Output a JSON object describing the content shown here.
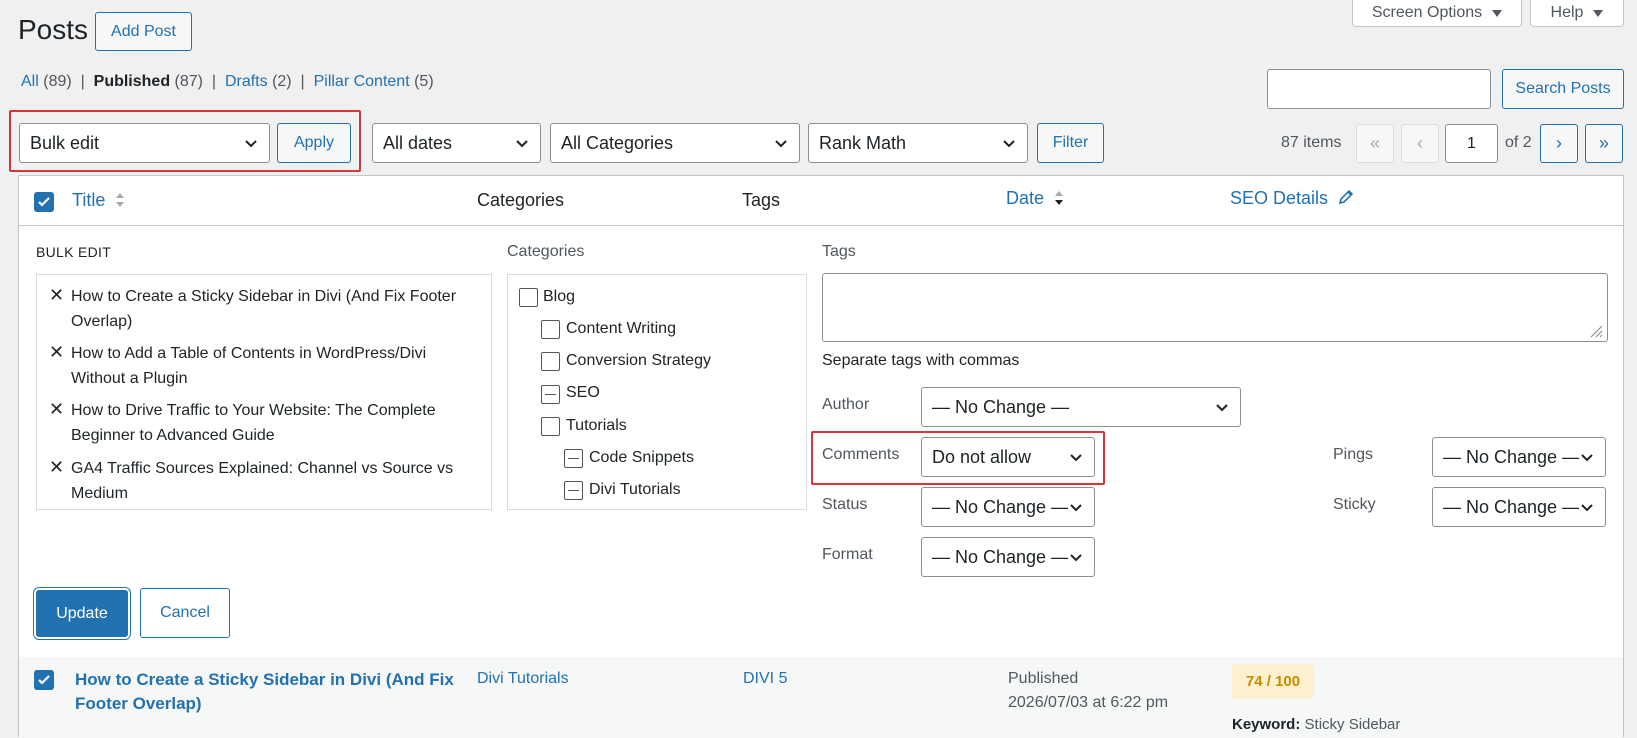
{
  "header": {
    "title": "Posts",
    "add_post": "Add Post",
    "screen_options": "Screen Options",
    "help": "Help"
  },
  "views": [
    {
      "label": "All",
      "count": "(89)",
      "current": false
    },
    {
      "label": "Published",
      "count": "(87)",
      "current": true
    },
    {
      "label": "Drafts",
      "count": "(2)",
      "current": false
    },
    {
      "label": "Pillar Content",
      "count": "(5)",
      "current": false
    }
  ],
  "search": {
    "value": "",
    "button": "Search Posts"
  },
  "toolbar": {
    "bulk_action": "Bulk edit",
    "apply": "Apply",
    "dates": "All dates",
    "categories": "All Categories",
    "rank_math": "Rank Math",
    "filter": "Filter"
  },
  "pagination": {
    "items": "87 items",
    "first": "«",
    "prev": "‹",
    "current_page": "1",
    "of": "of 2",
    "next": "›",
    "last": "»"
  },
  "columns": {
    "title": "Title",
    "categories": "Categories",
    "tags": "Tags",
    "date": "Date",
    "seo": "SEO Details"
  },
  "bulk_edit": {
    "heading": "BULK EDIT",
    "titles": [
      "How to Create a Sticky Sidebar in Divi (And Fix Footer Overlap)",
      "How to Add a Table of Contents in WordPress/Divi Without a Plugin",
      "How to Drive Traffic to Your Website: The Complete Beginner to Advanced Guide",
      "GA4 Traffic Sources Explained: Channel vs Source vs Medium"
    ],
    "categories_label": "Categories",
    "categories": [
      {
        "label": "Blog",
        "level": 0,
        "state": "empty"
      },
      {
        "label": "Content Writing",
        "level": 1,
        "state": "empty"
      },
      {
        "label": "Conversion Strategy",
        "level": 1,
        "state": "empty"
      },
      {
        "label": "SEO",
        "level": 1,
        "state": "indeterminate"
      },
      {
        "label": "Tutorials",
        "level": 1,
        "state": "empty"
      },
      {
        "label": "Code Snippets",
        "level": 2,
        "state": "indeterminate"
      },
      {
        "label": "Divi Tutorials",
        "level": 2,
        "state": "indeterminate"
      }
    ],
    "tags_label": "Tags",
    "tags_value": "",
    "tags_hint": "Separate tags with commas",
    "author_label": "Author",
    "author_value": "— No Change —",
    "comments_label": "Comments",
    "comments_value": "Do not allow",
    "status_label": "Status",
    "status_value": "— No Change —",
    "format_label": "Format",
    "format_value": "— No Change —",
    "pings_label": "Pings",
    "pings_value": "— No Change —",
    "sticky_label": "Sticky",
    "sticky_value": "— No Change —",
    "update": "Update",
    "cancel": "Cancel"
  },
  "post_row": {
    "title": "How to Create a Sticky Sidebar in Divi (And Fix Footer Overlap)",
    "category": "Divi Tutorials",
    "tag": "DIVI 5",
    "status": "Published",
    "datetime": "2026/07/03 at 6:22 pm",
    "seo_score": "74 / 100",
    "keyword_label": "Keyword:",
    "keyword_value": "Sticky Sidebar"
  },
  "colors": {
    "accent": "#2271b1",
    "highlight_box": "#d63638",
    "seo_badge_bg": "#fdf0cf",
    "seo_badge_text": "#c98a00"
  }
}
